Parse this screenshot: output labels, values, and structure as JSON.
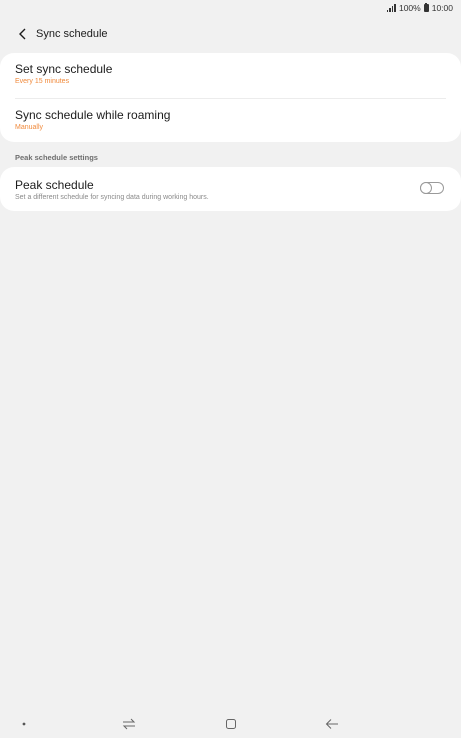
{
  "status_bar": {
    "battery": "100%",
    "time": "10:00",
    "icons": [
      "signal-icon",
      "battery-icon"
    ]
  },
  "header": {
    "title": "Sync schedule",
    "back_icon": "chevron-left-icon"
  },
  "sync_card": {
    "items": [
      {
        "title": "Set sync schedule",
        "subtitle": "Every 15 minutes"
      },
      {
        "title": "Sync schedule while roaming",
        "subtitle": "Manually"
      }
    ]
  },
  "peak_section": {
    "header": "Peak schedule settings",
    "item": {
      "title": "Peak schedule",
      "subtitle": "Set a different schedule for syncing data during working hours.",
      "toggle_on": false
    }
  },
  "nav_bar": {
    "icons": [
      "dot-icon",
      "recents-icon",
      "home-icon",
      "back-arrow-icon"
    ]
  },
  "colors": {
    "accent": "#f08a3c",
    "background": "#f1f1f1",
    "card": "#ffffff"
  }
}
